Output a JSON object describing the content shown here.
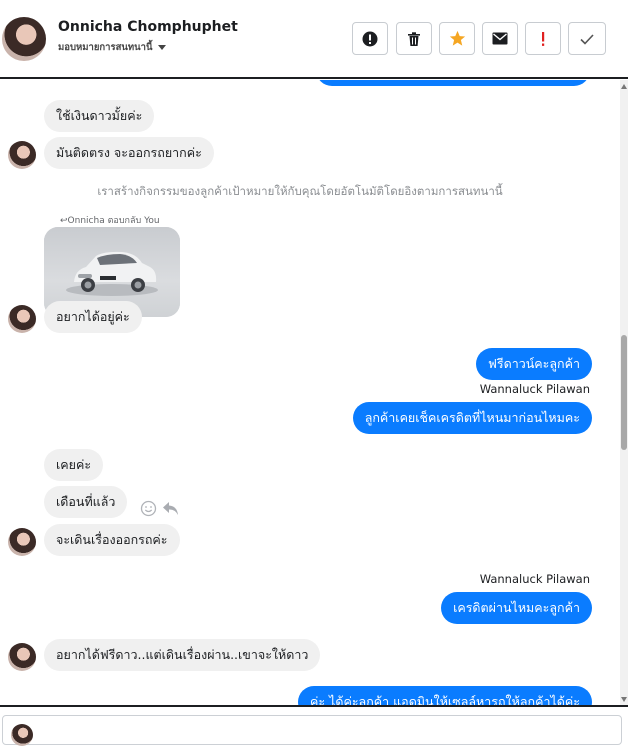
{
  "header": {
    "contact_name": "Onnicha Chomphuphet",
    "assign_label": "มอบหมายการสนทนานี้",
    "toolbar": [
      {
        "name": "info-button",
        "icon": "exclamation-circle-icon"
      },
      {
        "name": "delete-button",
        "icon": "trash-icon"
      },
      {
        "name": "star-button",
        "icon": "star-icon"
      },
      {
        "name": "mail-button",
        "icon": "envelope-icon"
      },
      {
        "name": "spam-button",
        "icon": "exclamation-icon"
      },
      {
        "name": "done-button",
        "icon": "check-icon"
      }
    ]
  },
  "chat": {
    "msg_in_1": "ใช้เงินดาวมั้ยค่ะ",
    "msg_in_2": "มันติดตรง  จะออกรถยากค่ะ",
    "system_notice": "เราสร้างกิจกรรมของลูกค้าเป้าหมายให้กับคุณโดยอัตโนมัติโดยอิงตามการสนทนานี้",
    "replied_caption": "Onnicha ตอบกลับ You",
    "msg_in_3": "อยากได้อยู่ค่ะ",
    "msg_out_1": "ฟรีดาวน์คะลูกค้า",
    "sender_1": "Wannaluck Pilawan",
    "msg_out_2": "ลูกค้าเคยเช็คเครดิตที่ไหนมาก่อนไหมคะ",
    "msg_in_4": "เคยค่ะ",
    "msg_in_5": "เดือนที่แล้ว",
    "msg_in_6": "จะเดินเรื่องออกรถค่ะ",
    "sender_2": "Wannaluck Pilawan",
    "msg_out_3": "เครดิตผ่านไหมคะลูกค้า",
    "msg_in_7": "อยากได้ฟรีดาว..แต่เดินเรื่องผ่าน..เขาจะให้ดาว",
    "msg_out_4_partial": "ค่ะ  ได้ค่ะลูกค้า  แอดมินให้เซลล์หารถให้ลูกค้าได้ค่ะ"
  },
  "colors": {
    "outgoing": "#0a7cff",
    "incoming": "#f0f0f0",
    "star": "#f5a623",
    "spam": "#e02020"
  }
}
